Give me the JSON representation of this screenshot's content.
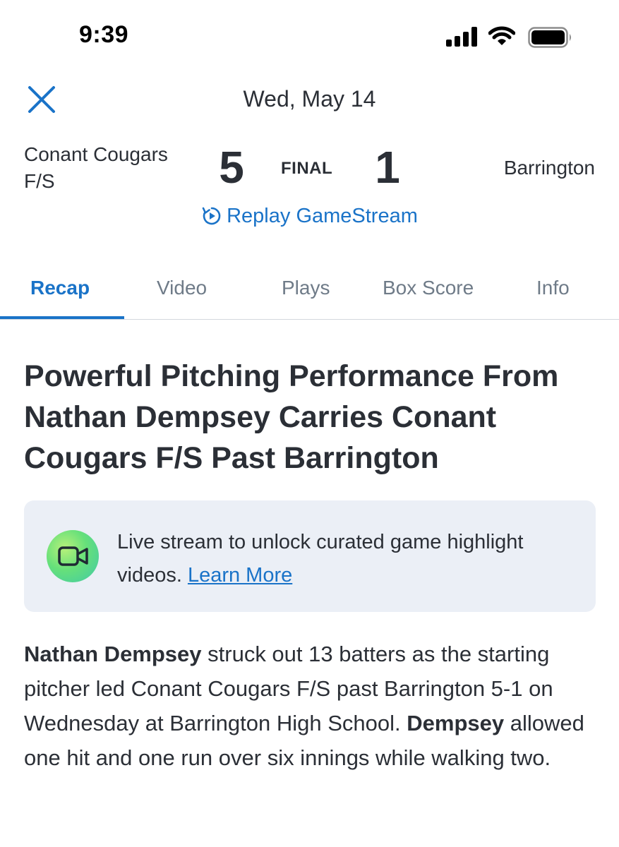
{
  "status_bar": {
    "time": "9:39"
  },
  "header": {
    "date": "Wed, May 14"
  },
  "game": {
    "home_team": "Conant Cougars F/S",
    "home_score": "5",
    "status": "FINAL",
    "away_score": "1",
    "away_team": "Barrington",
    "replay_label": "Replay GameStream"
  },
  "tabs": [
    {
      "label": "Recap",
      "active": true
    },
    {
      "label": "Video"
    },
    {
      "label": "Plays"
    },
    {
      "label": "Box Score"
    },
    {
      "label": "Info"
    }
  ],
  "recap": {
    "headline": "Powerful Pitching Performance From Nathan Dempsey Carries Conant Cougars F/S Past Barrington",
    "promo_text": "Live stream to unlock curated game highlight videos.",
    "promo_link": "Learn More",
    "p_name1": "Nathan Dempsey",
    "p_text1": " struck out 13 batters as the starting pitcher led Conant Cougars F/S past Barrington 5-1 on Wednesday at Barrington High School. ",
    "p_name2": "Dempsey",
    "p_text2": " allowed one hit and one run over six innings while walking two."
  },
  "colors": {
    "accent": "#1a73c8",
    "text": "#2b2f36",
    "tab_inactive": "#6f7b88",
    "promo_bg": "#ebeff6"
  },
  "icons": [
    "signal-icon",
    "wifi-icon",
    "battery-icon",
    "close-icon",
    "replay-icon",
    "video-camera-icon"
  ]
}
